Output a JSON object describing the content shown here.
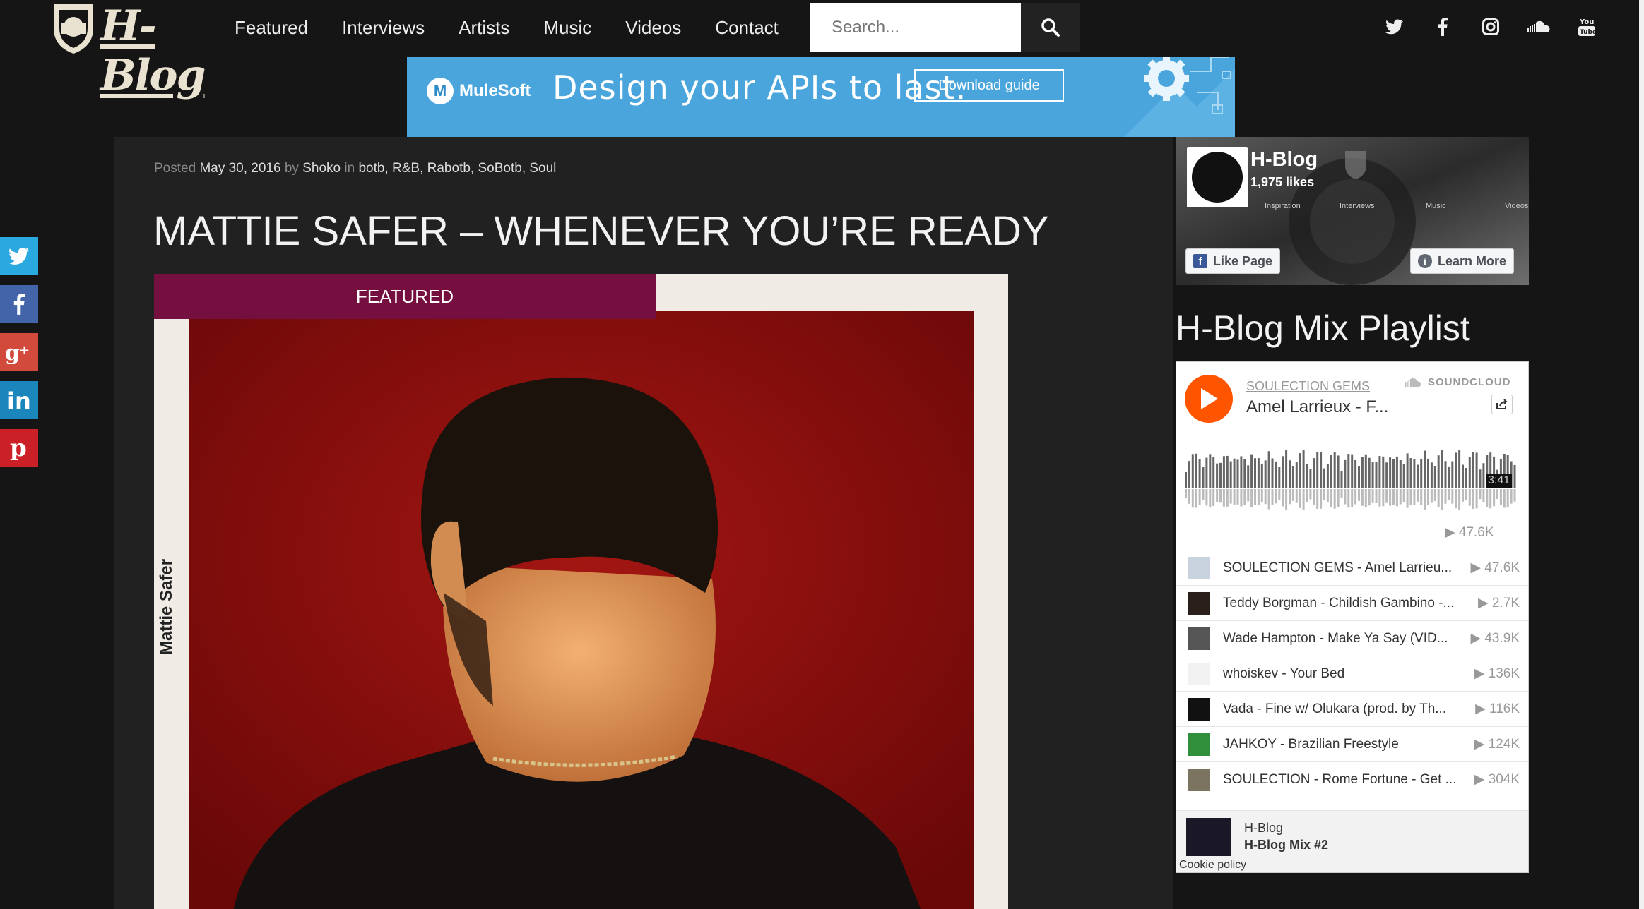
{
  "site": {
    "logo_text": "H-Blog"
  },
  "nav": {
    "items": [
      "Featured",
      "Interviews",
      "Artists",
      "Music",
      "Videos",
      "Contact"
    ]
  },
  "search": {
    "placeholder": "Search..."
  },
  "social_top": [
    "twitter-icon",
    "facebook-icon",
    "instagram-icon",
    "soundcloud-icon",
    "youtube-icon"
  ],
  "banner": {
    "brand": "MuleSoft",
    "headline": "Design your APIs to last.",
    "cta": "Download guide"
  },
  "share_bar": [
    {
      "icon": "twitter-icon",
      "color": "#2aa9e0"
    },
    {
      "icon": "facebook-icon",
      "color": "#4364a8"
    },
    {
      "icon": "google-plus-icon",
      "color": "#d24a3c"
    },
    {
      "icon": "linkedin-icon",
      "color": "#1b86bc"
    },
    {
      "icon": "pinterest-icon",
      "color": "#cb2027"
    }
  ],
  "post": {
    "posted_label": "Posted",
    "date": "May 30, 2016",
    "by_label": "by",
    "author": "Shoko",
    "in_label": "in",
    "categories": [
      "botb",
      "R&B",
      "Rabotb",
      "SoBotb",
      "Soul"
    ],
    "title": "MATTIE SAFER – WHENEVER YOU’RE READY",
    "featured_label": "FEATURED",
    "cover_text": "Mattie Safer"
  },
  "fb": {
    "name": "H-Blog",
    "likes": "1,975 likes",
    "tabs": [
      "Inspiration",
      "Interviews",
      "Music",
      "Videos"
    ],
    "like_btn": "Like Page",
    "learn_btn": "Learn More"
  },
  "playlist": {
    "heading": "H-Blog Mix Playlist",
    "user": "SOULECTION GEMS",
    "track": "Amel Larrieux - F...",
    "brand": "SOUNDCLOUD",
    "duration": "3:41",
    "plays": "47.6K",
    "tracks": [
      {
        "title": "SOULECTION GEMS - Amel Larrieu...",
        "count": "47.6K"
      },
      {
        "title": "Teddy Borgman - Childish Gambino -...",
        "count": "2.7K"
      },
      {
        "title": "Wade Hampton - Make Ya Say (VID...",
        "count": "43.9K"
      },
      {
        "title": "whoiskev - Your Bed",
        "count": "136K"
      },
      {
        "title": "Vada - Fine w/ Olukara (prod. by Th...",
        "count": "116K"
      },
      {
        "title": "JAHKOY - Brazilian Freestyle",
        "count": "124K"
      },
      {
        "title": "SOULECTION - Rome Fortune - Get ...",
        "count": "304K"
      }
    ],
    "footer_user": "H-Blog",
    "footer_title": "H-Blog Mix #2",
    "cookie": "Cookie policy"
  }
}
